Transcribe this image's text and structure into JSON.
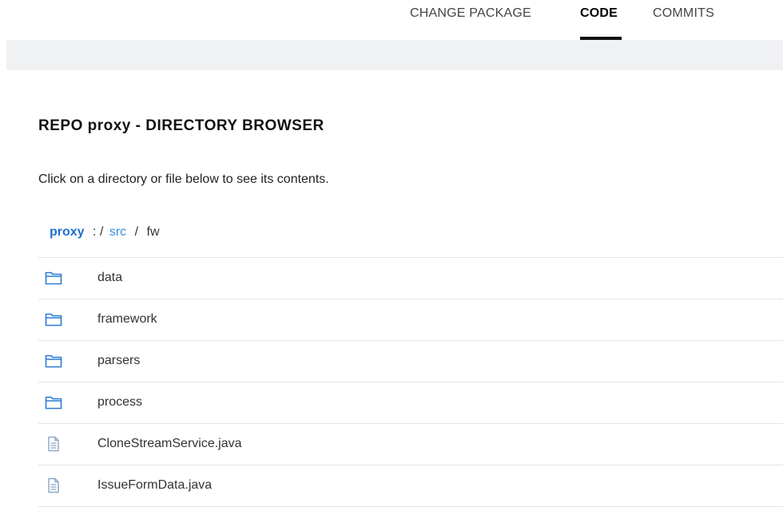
{
  "tabs": [
    {
      "label": "CHANGE PACKAGE",
      "active": false
    },
    {
      "label": "CODE",
      "active": true
    },
    {
      "label": "COMMITS",
      "active": false
    }
  ],
  "page": {
    "title": "REPO proxy - DIRECTORY BROWSER",
    "instructions": "Click on a directory or file below to see its contents."
  },
  "breadcrumb": {
    "root": "proxy",
    "separator_root": ":",
    "separator": "/",
    "segments": [
      "src",
      "fw"
    ]
  },
  "entries": [
    {
      "name": "data",
      "type": "folder",
      "icon": "folder-icon"
    },
    {
      "name": "framework",
      "type": "folder",
      "icon": "folder-icon"
    },
    {
      "name": "parsers",
      "type": "folder",
      "icon": "folder-icon"
    },
    {
      "name": "process",
      "type": "folder",
      "icon": "folder-icon"
    },
    {
      "name": "CloneStreamService.java",
      "type": "file",
      "icon": "file-icon"
    },
    {
      "name": "IssueFormData.java",
      "type": "file",
      "icon": "file-icon"
    }
  ],
  "colors": {
    "accent": "#1e6fcf",
    "link": "#3a8dde",
    "folder_icon": "#2b7bd6",
    "file_icon": "#8aa6c4",
    "band": "#f0f1f2"
  }
}
